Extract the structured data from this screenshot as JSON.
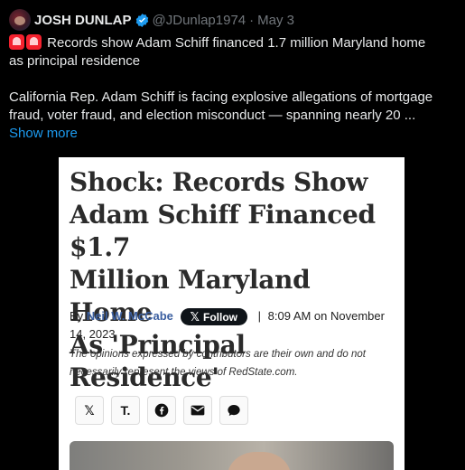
{
  "post": {
    "author_name": "JOSH DUNLAP",
    "handle": "@JDunlap1974",
    "separator": "·",
    "date": "May 3",
    "line1": "Records show Adam Schiff financed 1.7 million Maryland home",
    "line2": "as principal residence",
    "line3": "California Rep. Adam Schiff is facing explosive allegations of mortgage",
    "line4": "fraud, voter fraud, and election misconduct — spanning nearly 20 ...",
    "show_more": "Show more",
    "icons": {
      "avatar": "avatar",
      "verified": "verified-badge-icon",
      "siren": "police-light-emoji"
    },
    "colors": {
      "background": "#000000",
      "text": "#e7e9ea",
      "muted": "#71767b",
      "link": "#1d9bf0",
      "verified": "#1d9bf0"
    }
  },
  "article": {
    "headline_line1": "Shock: Records Show",
    "headline_line2": "Adam Schiff Financed $1.7",
    "headline_line3": "Million Maryland Home",
    "headline_line4": "As 'Principal Residence'",
    "by_label": "By",
    "author": "Neil W. McCabe",
    "follow_label": "Follow",
    "follow_icon": "x-logo-icon",
    "pipe": "|",
    "timestamp_line1": "8:09 AM on November",
    "timestamp_line2": "14, 2023",
    "disclaimer_line1": "The opinions expressed by contributors are their own and do not",
    "disclaimer_line2": "necessarily represent the views of RedState.com.",
    "share_buttons": [
      {
        "icon": "x-logo-icon",
        "glyph": "𝕏"
      },
      {
        "icon": "truth-social-icon",
        "glyph": "T."
      },
      {
        "icon": "facebook-icon",
        "glyph": "f"
      },
      {
        "icon": "email-icon",
        "glyph": "✉"
      },
      {
        "icon": "message-icon",
        "glyph": "●"
      }
    ]
  }
}
